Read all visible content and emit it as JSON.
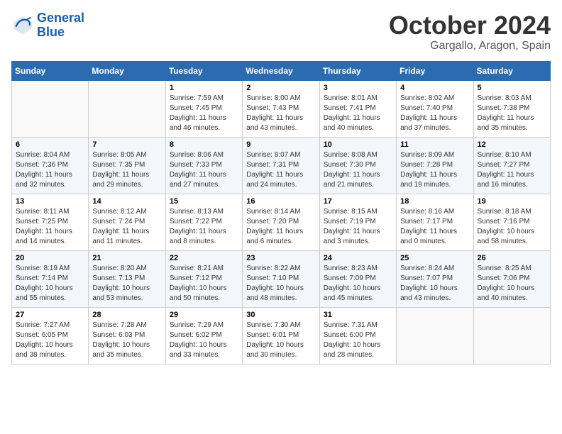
{
  "header": {
    "logo_line1": "General",
    "logo_line2": "Blue",
    "month": "October 2024",
    "location": "Gargallo, Aragon, Spain"
  },
  "columns": [
    "Sunday",
    "Monday",
    "Tuesday",
    "Wednesday",
    "Thursday",
    "Friday",
    "Saturday"
  ],
  "weeks": [
    [
      {
        "day": "",
        "info": ""
      },
      {
        "day": "",
        "info": ""
      },
      {
        "day": "1",
        "info": "Sunrise: 7:59 AM\nSunset: 7:45 PM\nDaylight: 11 hours and 46 minutes."
      },
      {
        "day": "2",
        "info": "Sunrise: 8:00 AM\nSunset: 7:43 PM\nDaylight: 11 hours and 43 minutes."
      },
      {
        "day": "3",
        "info": "Sunrise: 8:01 AM\nSunset: 7:41 PM\nDaylight: 11 hours and 40 minutes."
      },
      {
        "day": "4",
        "info": "Sunrise: 8:02 AM\nSunset: 7:40 PM\nDaylight: 11 hours and 37 minutes."
      },
      {
        "day": "5",
        "info": "Sunrise: 8:03 AM\nSunset: 7:38 PM\nDaylight: 11 hours and 35 minutes."
      }
    ],
    [
      {
        "day": "6",
        "info": "Sunrise: 8:04 AM\nSunset: 7:36 PM\nDaylight: 11 hours and 32 minutes."
      },
      {
        "day": "7",
        "info": "Sunrise: 8:05 AM\nSunset: 7:35 PM\nDaylight: 11 hours and 29 minutes."
      },
      {
        "day": "8",
        "info": "Sunrise: 8:06 AM\nSunset: 7:33 PM\nDaylight: 11 hours and 27 minutes."
      },
      {
        "day": "9",
        "info": "Sunrise: 8:07 AM\nSunset: 7:31 PM\nDaylight: 11 hours and 24 minutes."
      },
      {
        "day": "10",
        "info": "Sunrise: 8:08 AM\nSunset: 7:30 PM\nDaylight: 11 hours and 21 minutes."
      },
      {
        "day": "11",
        "info": "Sunrise: 8:09 AM\nSunset: 7:28 PM\nDaylight: 11 hours and 19 minutes."
      },
      {
        "day": "12",
        "info": "Sunrise: 8:10 AM\nSunset: 7:27 PM\nDaylight: 11 hours and 16 minutes."
      }
    ],
    [
      {
        "day": "13",
        "info": "Sunrise: 8:11 AM\nSunset: 7:25 PM\nDaylight: 11 hours and 14 minutes."
      },
      {
        "day": "14",
        "info": "Sunrise: 8:12 AM\nSunset: 7:24 PM\nDaylight: 11 hours and 11 minutes."
      },
      {
        "day": "15",
        "info": "Sunrise: 8:13 AM\nSunset: 7:22 PM\nDaylight: 11 hours and 8 minutes."
      },
      {
        "day": "16",
        "info": "Sunrise: 8:14 AM\nSunset: 7:20 PM\nDaylight: 11 hours and 6 minutes."
      },
      {
        "day": "17",
        "info": "Sunrise: 8:15 AM\nSunset: 7:19 PM\nDaylight: 11 hours and 3 minutes."
      },
      {
        "day": "18",
        "info": "Sunrise: 8:16 AM\nSunset: 7:17 PM\nDaylight: 11 hours and 0 minutes."
      },
      {
        "day": "19",
        "info": "Sunrise: 8:18 AM\nSunset: 7:16 PM\nDaylight: 10 hours and 58 minutes."
      }
    ],
    [
      {
        "day": "20",
        "info": "Sunrise: 8:19 AM\nSunset: 7:14 PM\nDaylight: 10 hours and 55 minutes."
      },
      {
        "day": "21",
        "info": "Sunrise: 8:20 AM\nSunset: 7:13 PM\nDaylight: 10 hours and 53 minutes."
      },
      {
        "day": "22",
        "info": "Sunrise: 8:21 AM\nSunset: 7:12 PM\nDaylight: 10 hours and 50 minutes."
      },
      {
        "day": "23",
        "info": "Sunrise: 8:22 AM\nSunset: 7:10 PM\nDaylight: 10 hours and 48 minutes."
      },
      {
        "day": "24",
        "info": "Sunrise: 8:23 AM\nSunset: 7:09 PM\nDaylight: 10 hours and 45 minutes."
      },
      {
        "day": "25",
        "info": "Sunrise: 8:24 AM\nSunset: 7:07 PM\nDaylight: 10 hours and 43 minutes."
      },
      {
        "day": "26",
        "info": "Sunrise: 8:25 AM\nSunset: 7:06 PM\nDaylight: 10 hours and 40 minutes."
      }
    ],
    [
      {
        "day": "27",
        "info": "Sunrise: 7:27 AM\nSunset: 6:05 PM\nDaylight: 10 hours and 38 minutes."
      },
      {
        "day": "28",
        "info": "Sunrise: 7:28 AM\nSunset: 6:03 PM\nDaylight: 10 hours and 35 minutes."
      },
      {
        "day": "29",
        "info": "Sunrise: 7:29 AM\nSunset: 6:02 PM\nDaylight: 10 hours and 33 minutes."
      },
      {
        "day": "30",
        "info": "Sunrise: 7:30 AM\nSunset: 6:01 PM\nDaylight: 10 hours and 30 minutes."
      },
      {
        "day": "31",
        "info": "Sunrise: 7:31 AM\nSunset: 6:00 PM\nDaylight: 10 hours and 28 minutes."
      },
      {
        "day": "",
        "info": ""
      },
      {
        "day": "",
        "info": ""
      }
    ]
  ]
}
